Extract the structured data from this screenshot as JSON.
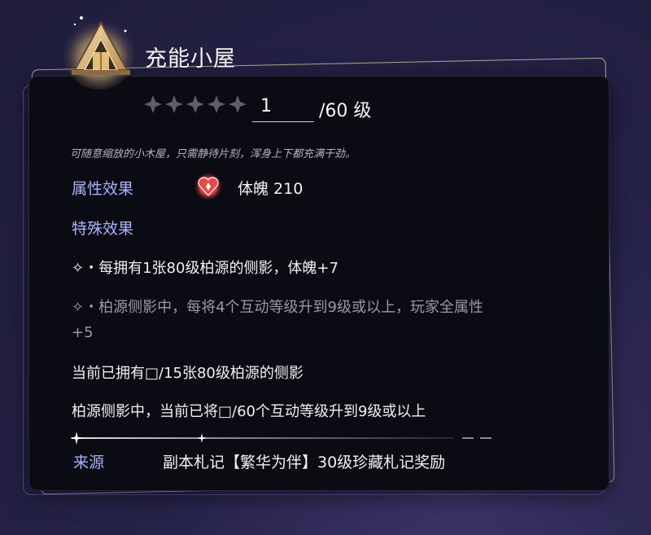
{
  "item": {
    "icon": "house-icon",
    "title": "充能小屋",
    "stars_count": 5,
    "level_current": "1",
    "level_max": "/60 级",
    "description": "可随意缩放的小木屋，只需静待片刻，浑身上下都充满干劲。"
  },
  "attributes": {
    "label": "属性效果",
    "icon": "heart-diamond-icon",
    "value": "体魄  210"
  },
  "special": {
    "label": "特殊效果",
    "effect1": "✧・每拥有1张80级柏源的侧影，体魄+7",
    "effect2_line1": "✧・柏源侧影中，每将4个互动等级升到9级或以上，玩家全属性",
    "effect2_line2": "+5",
    "progress1": "当前已拥有□/15张80级柏源的侧影",
    "progress2": "柏源侧影中，当前已将□/60个互动等级升到9级或以上"
  },
  "source": {
    "label": "来源",
    "value": "副本札记【繁华为伴】30级珍藏札记奖励"
  },
  "colors": {
    "accent_label": "#a9b3ff",
    "panel_bg": "#0b0b13",
    "frame_gold": "#d6c49e"
  }
}
